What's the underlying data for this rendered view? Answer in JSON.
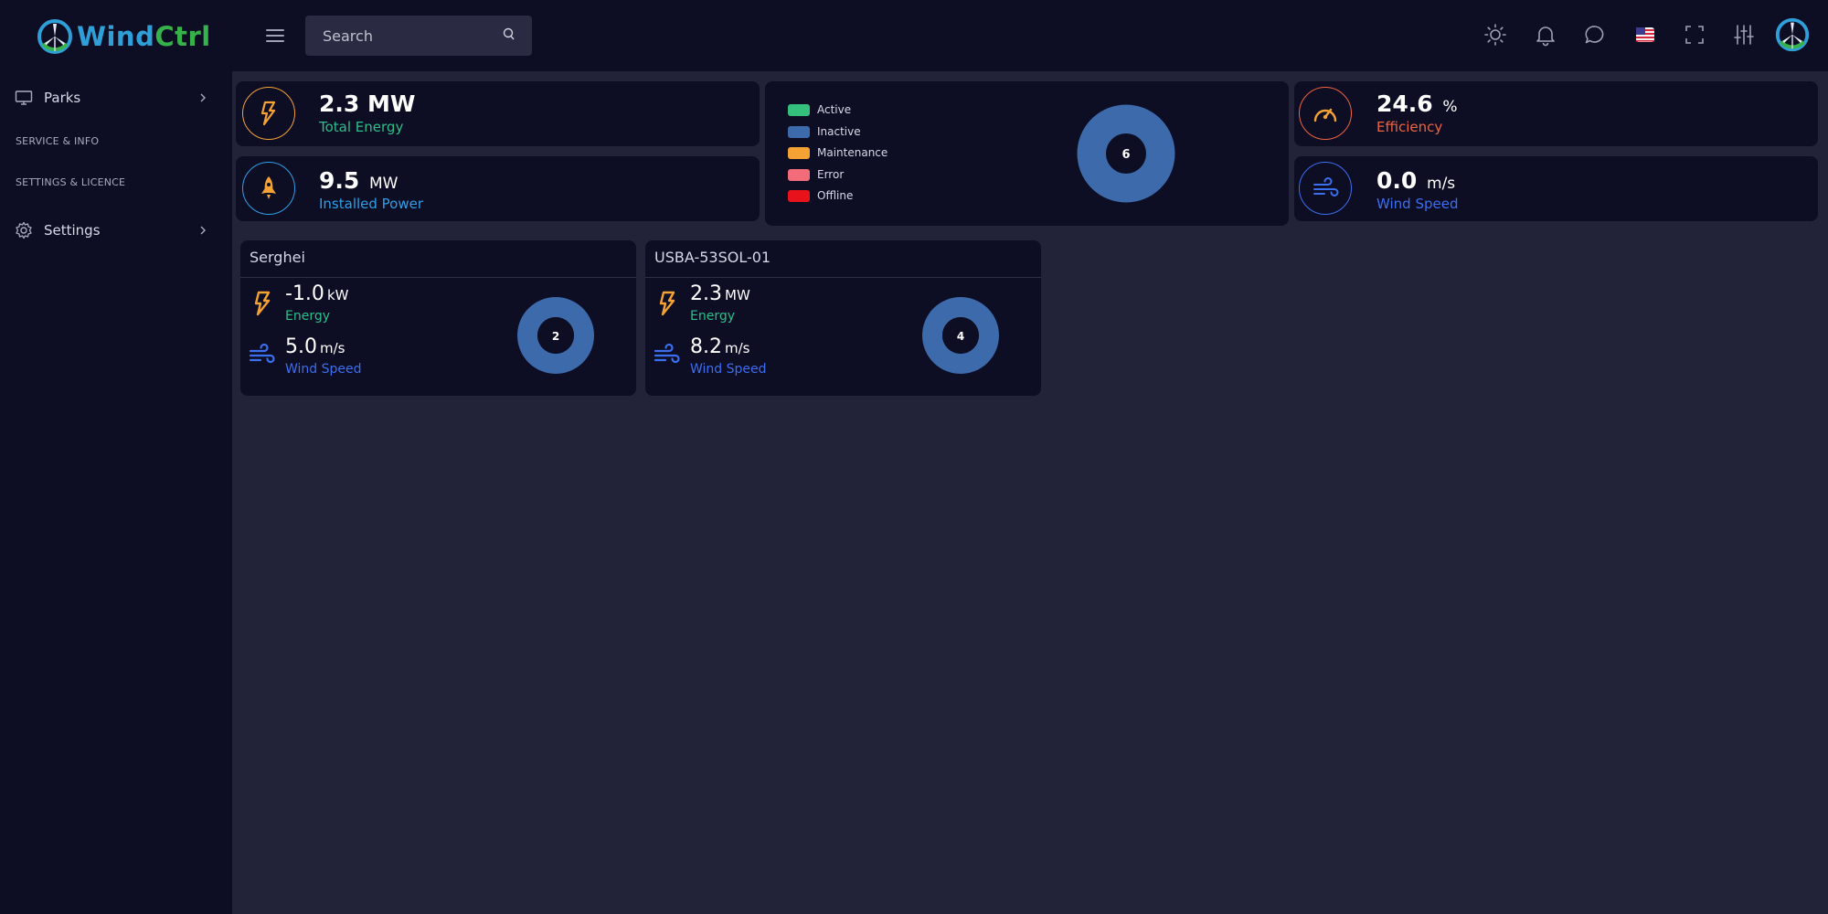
{
  "app": {
    "logo_wind": "Wind",
    "logo_ctrl": "Ctrl"
  },
  "header": {
    "search_placeholder": "Search",
    "icons": [
      "menu-icon",
      "search-icon",
      "sun-icon",
      "bell-icon",
      "chat-icon",
      "us-flag-icon",
      "fullscreen-icon",
      "sliders-icon",
      "avatar"
    ]
  },
  "sidebar": {
    "items": [
      {
        "label": "Parks",
        "icon": "monitor-icon"
      },
      {
        "label": "Settings",
        "icon": "gear-icon"
      }
    ],
    "headings": [
      "SERVICE & INFO",
      "SETTINGS & LICENCE"
    ]
  },
  "stats": {
    "total_energy": {
      "value": "2.3",
      "unit": "MW",
      "label": "Total Energy",
      "color": "#2cbf8a",
      "icon": "bolt-icon"
    },
    "installed_power": {
      "value": "9.5",
      "unit": "MW",
      "label": "Installed Power",
      "color": "#2e9fe8",
      "icon": "rocket-icon"
    },
    "efficiency": {
      "value": "24.6",
      "unit": "%",
      "label": "Efficiency",
      "color": "#f0633f",
      "icon": "speedometer-icon"
    },
    "wind_speed": {
      "value": "0.0",
      "unit": "m/s",
      "label": "Wind Speed",
      "color": "#3c6ef0",
      "icon": "wind-icon"
    }
  },
  "status_chart": {
    "center_label": "6",
    "legend": [
      {
        "label": "Active",
        "color": "#34c07c"
      },
      {
        "label": "Inactive",
        "color": "#3d6aab"
      },
      {
        "label": "Maintenance",
        "color": "#f4a233"
      },
      {
        "label": "Error",
        "color": "#f26c7a"
      },
      {
        "label": "Offline",
        "color": "#e8121b"
      }
    ],
    "ring_color": "#3d6aab"
  },
  "parks": [
    {
      "name": "Serghei",
      "energy_value": "-1.0",
      "energy_unit": "kW",
      "energy_label": "Energy",
      "wind_value": "5.0",
      "wind_unit": "m/s",
      "wind_label": "Wind Speed",
      "turbines": "2"
    },
    {
      "name": "USBA-53SOL-01",
      "energy_value": "2.3",
      "energy_unit": "MW",
      "energy_label": "Energy",
      "wind_value": "8.2",
      "wind_unit": "m/s",
      "wind_label": "Wind Speed",
      "turbines": "4"
    }
  ],
  "colors": {
    "bg": "#222239",
    "panel": "#0d0e24",
    "energy_green": "#2cbf8a",
    "wind_blue": "#3c6ef0",
    "bolt_orange": "#f4a233"
  }
}
